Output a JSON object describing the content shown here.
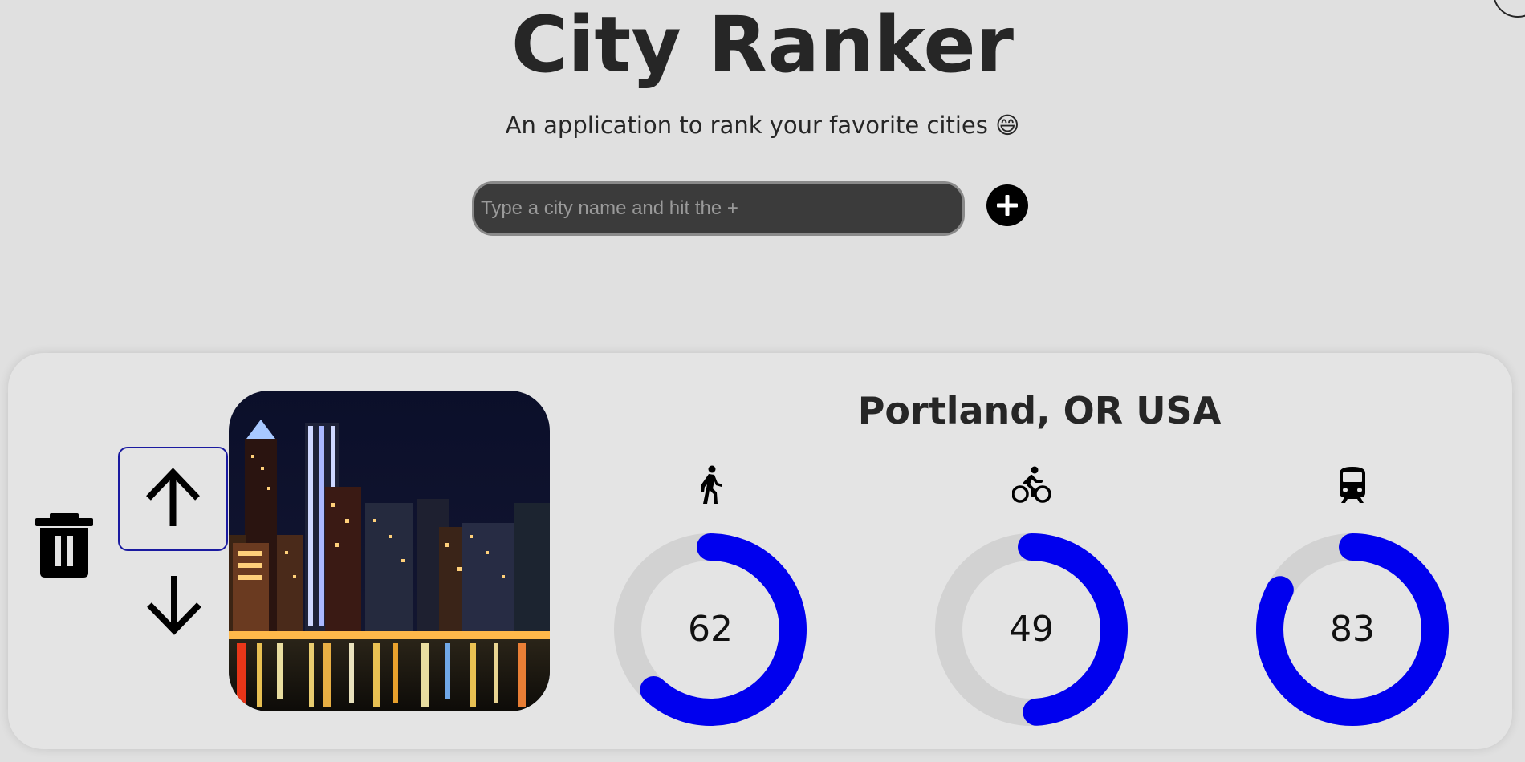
{
  "app": {
    "title": "City Ranker",
    "subtitle": "An application to rank your favorite cities 😄"
  },
  "search": {
    "value": "",
    "placeholder": "Type a city name and hit the +",
    "add_icon": "plus-circle-icon"
  },
  "colors": {
    "background": "#e0e0e0",
    "gauge_fill": "#0000ee",
    "gauge_track": "#d2d2d2"
  },
  "cities": [
    {
      "name": "Portland, OR USA",
      "controls": {
        "delete_icon": "trash-icon",
        "move_up_icon": "arrow-up-icon",
        "move_down_icon": "arrow-down-icon"
      },
      "scores": [
        {
          "icon": "walking-icon",
          "value": 62
        },
        {
          "icon": "bicycle-icon",
          "value": 49
        },
        {
          "icon": "train-icon",
          "value": 83
        }
      ]
    }
  ]
}
